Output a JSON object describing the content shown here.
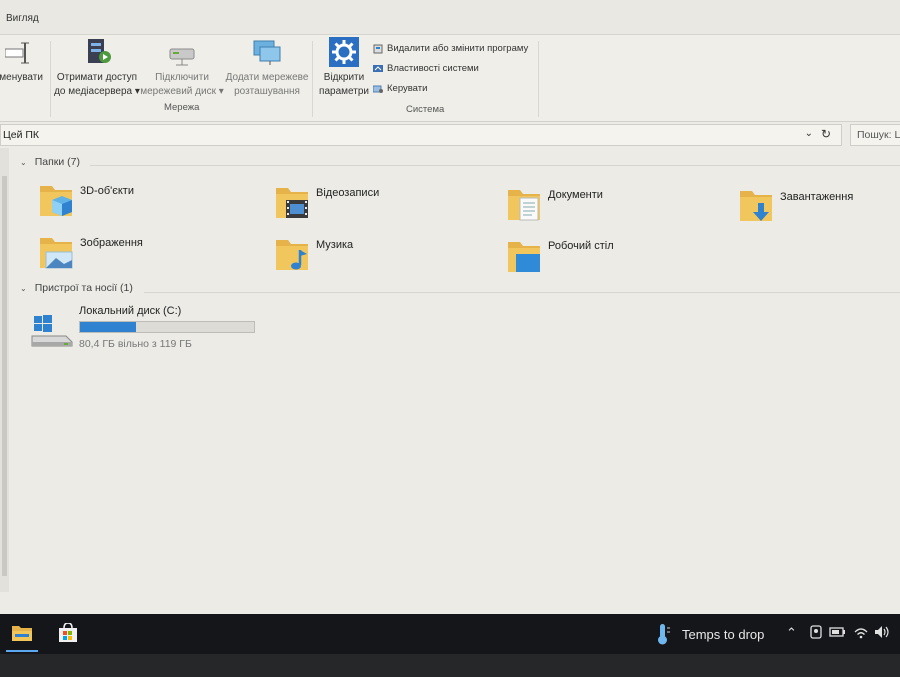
{
  "ribbon": {
    "tab": "Вигляд",
    "rename_partial": "іменувати",
    "media_server": [
      "Отримати доступ",
      "до медіасервера"
    ],
    "map_drive": [
      "Підключити",
      "мережевий диск"
    ],
    "add_location": [
      "Додати мережеве",
      "розташування"
    ],
    "network_group": "Мережа",
    "open_settings": [
      "Відкрити",
      "параметри"
    ],
    "uninstall": "Видалити або змінити програму",
    "system_props": "Властивості системи",
    "manage": "Керувати",
    "system_group": "Система"
  },
  "address": {
    "path": "Цей ПК",
    "dropdown_icon": "chevron-down-icon",
    "refresh_icon": "refresh-icon",
    "search_placeholder": "Пошук: Ц"
  },
  "folders_section": {
    "title": "Папки (7)",
    "items": [
      {
        "label": "3D-об'єкти",
        "icon": "3d-objects-folder-icon"
      },
      {
        "label": "Відеозаписи",
        "icon": "videos-folder-icon"
      },
      {
        "label": "Документи",
        "icon": "documents-folder-icon"
      },
      {
        "label": "Завантаження",
        "icon": "downloads-folder-icon"
      },
      {
        "label": "Зображення",
        "icon": "pictures-folder-icon"
      },
      {
        "label": "Музика",
        "icon": "music-folder-icon"
      },
      {
        "label": "Робочий стіл",
        "icon": "desktop-folder-icon"
      }
    ]
  },
  "devices_section": {
    "title": "Пристрої та носії (1)",
    "drive": {
      "label": "Локальний диск (C:)",
      "free_text": "80,4 ГБ вільно з 119 ГБ",
      "used_fraction": 0.32
    }
  },
  "taskbar": {
    "weather_text": "Temps to drop",
    "apps": [
      "file-explorer-icon",
      "store-icon"
    ]
  },
  "colors": {
    "accent": "#2f82cf",
    "folder": "#e8b94a",
    "taskbar": "#14161a"
  }
}
